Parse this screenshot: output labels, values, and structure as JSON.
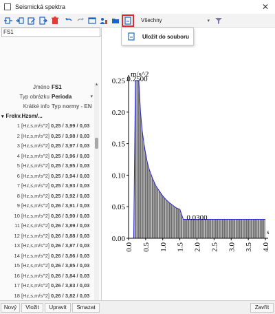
{
  "window": {
    "title": "Seismická spektra",
    "close_glyph": "✕",
    "icon": "app-window-icon"
  },
  "toolbar": {
    "icons": [
      "new-icon",
      "insert-icon",
      "edit-icon",
      "import-icon",
      "delete-icon",
      "undo-icon",
      "redo-icon",
      "table-icon",
      "user-settings-icon",
      "open-folder-icon",
      "save-to-file-icon"
    ],
    "filter_value": "Všechny",
    "filter_chevron": "▾",
    "funnel_icon": "filter-icon",
    "highlight_color": "#d32f2f",
    "accent": "#1e64c8"
  },
  "popup": {
    "label": "Uložit do souboru",
    "icon": "save-file-icon"
  },
  "left": {
    "list_items": [
      "FS1"
    ],
    "props": [
      {
        "label": "Jméno",
        "value": "FS1"
      },
      {
        "label": "Typ obrázku",
        "value": "Perioda",
        "has_dropdown": true
      },
      {
        "label": "Krátké info",
        "value": "Typ normy - EN",
        "muted": true
      }
    ],
    "section": {
      "label": "Frekv.Hzsm/...",
      "chevron": "▾"
    },
    "freq_rows": [
      {
        "label": "1 [Hz,s,m/s^2]",
        "value": "0,25 / 3,99 / 0,03"
      },
      {
        "label": "2 [Hz,s,m/s^2]",
        "value": "0,25 / 3,98 / 0,03"
      },
      {
        "label": "3 [Hz,s,m/s^2]",
        "value": "0,25 / 3,97 / 0,03"
      },
      {
        "label": "4 [Hz,s,m/s^2]",
        "value": "0,25 / 3,96 / 0,03"
      },
      {
        "label": "5 [Hz,s,m/s^2]",
        "value": "0,25 / 3,95 / 0,03"
      },
      {
        "label": "6 [Hz,s,m/s^2]",
        "value": "0,25 / 3,94 / 0,03"
      },
      {
        "label": "7 [Hz,s,m/s^2]",
        "value": "0,25 / 3,93 / 0,03"
      },
      {
        "label": "8 [Hz,s,m/s^2]",
        "value": "0,25 / 3,92 / 0,03"
      },
      {
        "label": "9 [Hz,s,m/s^2]",
        "value": "0,26 / 3,91 / 0,03"
      },
      {
        "label": "10 [Hz,s,m/s^2]",
        "value": "0,26 / 3,90 / 0,03"
      },
      {
        "label": "11 [Hz,s,m/s^2]",
        "value": "0,26 / 3,89 / 0,03"
      },
      {
        "label": "12 [Hz,s,m/s^2]",
        "value": "0,26 / 3,88 / 0,03"
      },
      {
        "label": "13 [Hz,s,m/s^2]",
        "value": "0,26 / 3,87 / 0,03"
      },
      {
        "label": "14 [Hz,s,m/s^2]",
        "value": "0,26 / 3,86 / 0,03"
      },
      {
        "label": "15 [Hz,s,m/s^2]",
        "value": "0,26 / 3,85 / 0,03"
      },
      {
        "label": "16 [Hz,s,m/s^2]",
        "value": "0,26 / 3,84 / 0,03"
      },
      {
        "label": "17 [Hz,s,m/s^2]",
        "value": "0,26 / 3,83 / 0,03"
      },
      {
        "label": "18 [Hz,s,m/s^2]",
        "value": "0,26 / 3,82 / 0,03"
      }
    ]
  },
  "bottom": {
    "buttons": [
      "Nový",
      "Vložit",
      "Upravit",
      "Smazat"
    ],
    "close_label": "Zavřít"
  },
  "chart_data": {
    "type": "area",
    "title": "",
    "xlabel": "",
    "ylabel": "m/s^2",
    "xlim": [
      0.0,
      4.0
    ],
    "ylim": [
      0.0,
      0.25
    ],
    "x_ticks": [
      "0.0",
      "0.5",
      "1.0",
      "1.5",
      "2.0",
      "2.5",
      "3.0",
      "3.5",
      "4.0"
    ],
    "y_ticks": [
      "0.00",
      "0.05",
      "0.10",
      "0.15",
      "0.20",
      "0.25"
    ],
    "annotations": [
      {
        "text": "0.2500",
        "x": 0.25,
        "y": 0.25
      },
      {
        "text": "0.0300",
        "x": 2.0,
        "y": 0.03
      }
    ],
    "axis_end_label": "s",
    "fill_color": "#6b6b6b",
    "line_color": "#2b2bd0",
    "series": [
      {
        "x": [
          0.0,
          0.15,
          0.2,
          0.25,
          0.3,
          0.35,
          0.4,
          0.45,
          0.5,
          0.55,
          0.6,
          0.7,
          0.8,
          0.9,
          1.0,
          1.1,
          1.2,
          1.3,
          1.4,
          1.5,
          1.6,
          1.7,
          1.8,
          2.0,
          2.5,
          3.0,
          3.5,
          4.0
        ],
        "y": [
          0.0,
          0.0,
          0.25,
          0.25,
          0.25,
          0.2,
          0.17,
          0.15,
          0.134,
          0.12,
          0.11,
          0.095,
          0.083,
          0.075,
          0.067,
          0.061,
          0.056,
          0.052,
          0.048,
          0.046,
          0.03,
          0.03,
          0.03,
          0.03,
          0.03,
          0.03,
          0.03,
          0.03
        ]
      }
    ]
  }
}
